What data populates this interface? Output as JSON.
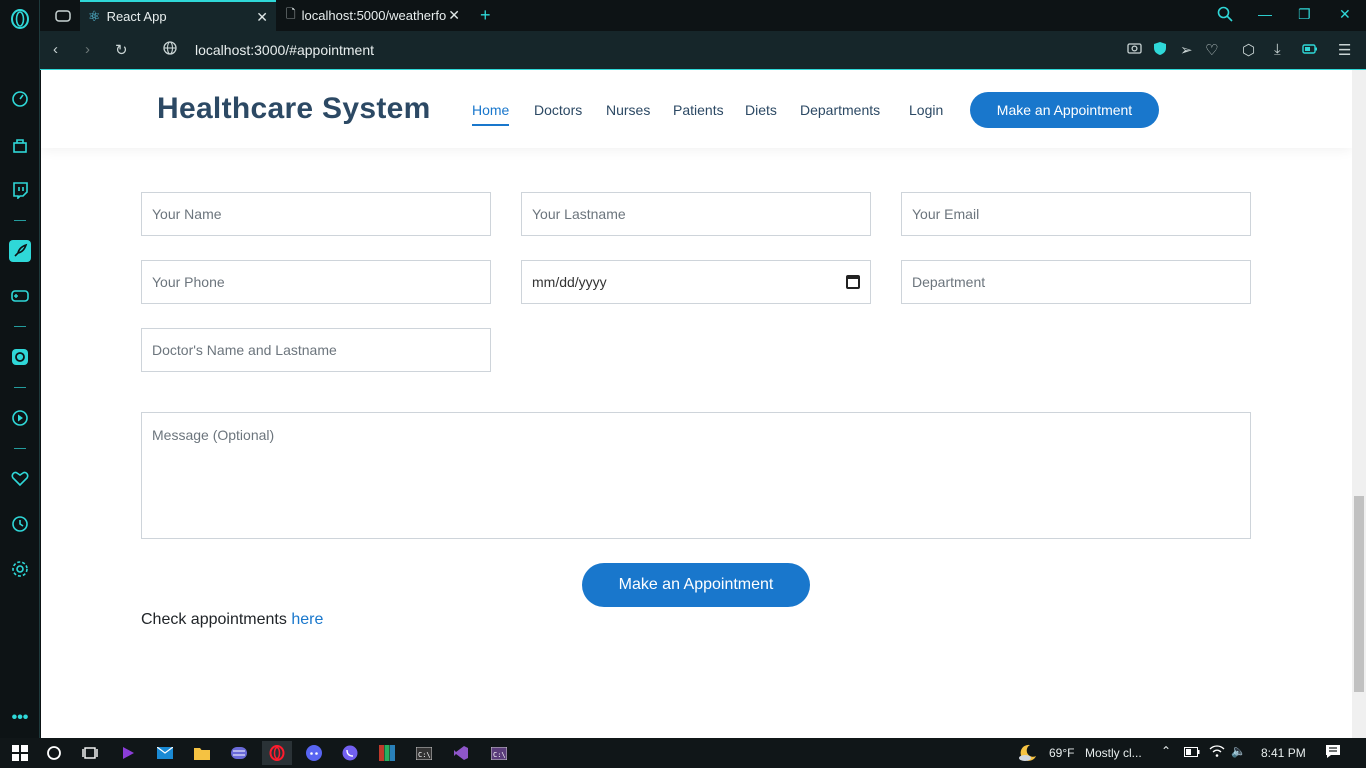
{
  "browser": {
    "tabs": [
      {
        "label": "React App",
        "active": true
      },
      {
        "label": "localhost:5000/weatherfore",
        "active": false
      }
    ],
    "url": "localhost:3000/#appointment"
  },
  "site": {
    "logo": "Healthcare System",
    "nav": [
      "Home",
      "Doctors",
      "Nurses",
      "Patients",
      "Diets",
      "Departments",
      "Login"
    ],
    "header_button": "Make an Appointment"
  },
  "form": {
    "name_placeholder": "Your Name",
    "lastname_placeholder": "Your Lastname",
    "email_placeholder": "Your Email",
    "phone_placeholder": "Your Phone",
    "date_placeholder": "mm/dd/yyyy",
    "department_placeholder": "Department",
    "doctor_placeholder": "Doctor's Name and Lastname",
    "message_placeholder": "Message (Optional)",
    "submit_label": "Make an Appointment",
    "check_text": "Check appointments ",
    "check_link": "here"
  },
  "taskbar": {
    "weather_temp": "69°F",
    "weather_text": "Mostly cl...",
    "time": "8:41 PM"
  },
  "colors": {
    "accent": "#1977cc",
    "heading": "#2c4964",
    "opera_accent": "#2fd8d8"
  }
}
